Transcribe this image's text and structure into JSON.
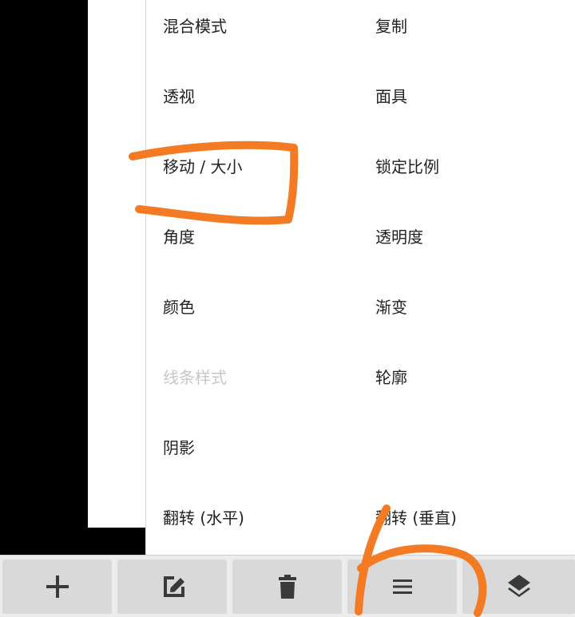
{
  "menu": {
    "items": [
      {
        "label": "混合模式",
        "enabled": true
      },
      {
        "label": "复制",
        "enabled": true
      },
      {
        "label": "透视",
        "enabled": true
      },
      {
        "label": "面具",
        "enabled": true
      },
      {
        "label": "移动 / 大小",
        "enabled": true
      },
      {
        "label": "锁定比例",
        "enabled": true
      },
      {
        "label": "角度",
        "enabled": true
      },
      {
        "label": "透明度",
        "enabled": true
      },
      {
        "label": "颜色",
        "enabled": true
      },
      {
        "label": "渐变",
        "enabled": true
      },
      {
        "label": "线条样式",
        "enabled": false
      },
      {
        "label": "轮廓",
        "enabled": true
      },
      {
        "label": "阴影",
        "enabled": true
      },
      {
        "label": "翻转 (水平)",
        "enabled": true
      },
      {
        "label": "翻转 (垂直)",
        "enabled": true
      }
    ]
  },
  "toolbar": {
    "buttons": [
      {
        "icon": "plus-icon"
      },
      {
        "icon": "edit-icon"
      },
      {
        "icon": "trash-icon"
      },
      {
        "icon": "menu-icon"
      },
      {
        "icon": "layers-icon"
      }
    ]
  },
  "colors": {
    "annotation": "#f47a24",
    "disabled_text": "#c7c7c7",
    "toolbar_button": "#d9d9d9",
    "icon": "#3a3a3a"
  }
}
